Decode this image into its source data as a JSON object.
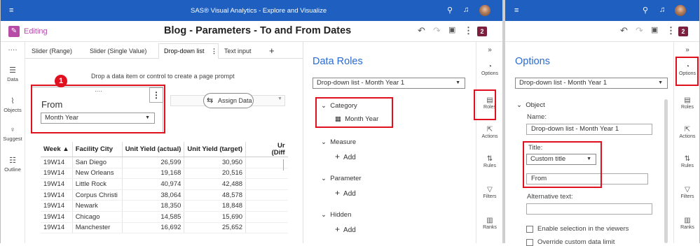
{
  "app_title": "SAS® Visual Analytics - Explore and Visualize",
  "editing_label": "Editing",
  "report_title": "Blog - Parameters - To and From Dates",
  "badge": "2",
  "left_rail": [
    {
      "label": "Data",
      "icon": "data-icon"
    },
    {
      "label": "Objects",
      "icon": "objects-icon"
    },
    {
      "label": "Suggest",
      "icon": "suggest-icon"
    },
    {
      "label": "Outline",
      "icon": "outline-icon"
    }
  ],
  "tabs": [
    "Slider (Range)",
    "Slider (Single Value)",
    "Drop-down list",
    "Text input"
  ],
  "tab_menu_glyph": "⋮",
  "tab_overflow_glyph": "····",
  "add_tab_glyph": "+",
  "drop_hint": "Drop a data item or control to create a page prompt",
  "callout_number": "1",
  "control": {
    "title": "From",
    "value": "Month Year"
  },
  "assign_data": "Assign Data",
  "table": {
    "headers": [
      "Week ▲",
      "Facility City",
      "Unit Yield (actual)",
      "Unit Yield (target)",
      "Ur"
    ],
    "extra_header_line": "(Diff",
    "rows": [
      [
        "19W14",
        "San Diego",
        "26,599",
        "30,950"
      ],
      [
        "19W14",
        "New Orleans",
        "19,168",
        "20,516"
      ],
      [
        "19W14",
        "Little Rock",
        "40,974",
        "42,488"
      ],
      [
        "19W14",
        "Corpus Christi",
        "38,064",
        "48,578"
      ],
      [
        "19W14",
        "Newark",
        "18,350",
        "18,848"
      ],
      [
        "19W14",
        "Chicago",
        "14,585",
        "15,690"
      ],
      [
        "19W14",
        "Manchester",
        "16,692",
        "25,652"
      ]
    ]
  },
  "data_roles": {
    "title": "Data Roles",
    "object_select": "Drop-down list - Month Year 1",
    "category_label": "Category",
    "category_item": "Month Year",
    "measure_label": "Measure",
    "parameter_label": "Parameter",
    "hidden_label": "Hidden",
    "add_label": "Add"
  },
  "right_rail": [
    {
      "label": "Options",
      "icon": "options-icon"
    },
    {
      "label": "Roles",
      "icon": "roles-icon"
    },
    {
      "label": "Actions",
      "icon": "actions-icon"
    },
    {
      "label": "Rules",
      "icon": "rules-icon"
    },
    {
      "label": "Filters",
      "icon": "filters-icon"
    },
    {
      "label": "Ranks",
      "icon": "ranks-icon"
    }
  ],
  "options": {
    "title": "Options",
    "object_select": "Drop-down list - Month Year 1",
    "object_label": "Object",
    "name_label": "Name:",
    "name_value": "Drop-down list - Month Year 1",
    "title_label": "Title:",
    "title_mode": "Custom title",
    "title_value": "From",
    "alt_label": "Alternative text:",
    "enable_selection": "Enable selection in the viewers",
    "override_label": "Override custom data limit"
  },
  "colors": {
    "topbar": "#1f5fbf",
    "accent": "#2a6ad3",
    "highlight": "#e0101f",
    "editing": "#b64ba8",
    "badge": "#7a1f3d"
  }
}
